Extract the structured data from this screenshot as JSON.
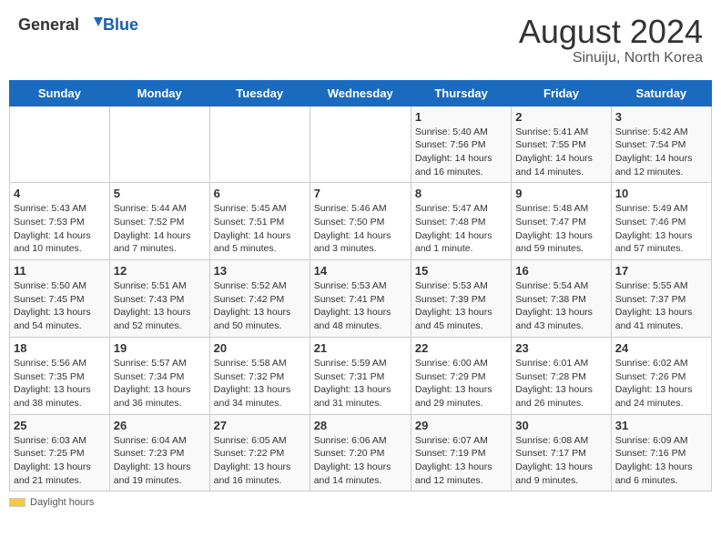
{
  "header": {
    "logo_general": "General",
    "logo_blue": "Blue",
    "title": "August 2024",
    "subtitle": "Sinuiju, North Korea"
  },
  "days_of_week": [
    "Sunday",
    "Monday",
    "Tuesday",
    "Wednesday",
    "Thursday",
    "Friday",
    "Saturday"
  ],
  "weeks": [
    [
      {
        "day": "",
        "info": ""
      },
      {
        "day": "",
        "info": ""
      },
      {
        "day": "",
        "info": ""
      },
      {
        "day": "",
        "info": ""
      },
      {
        "day": "1",
        "info": "Sunrise: 5:40 AM\nSunset: 7:56 PM\nDaylight: 14 hours and 16 minutes."
      },
      {
        "day": "2",
        "info": "Sunrise: 5:41 AM\nSunset: 7:55 PM\nDaylight: 14 hours and 14 minutes."
      },
      {
        "day": "3",
        "info": "Sunrise: 5:42 AM\nSunset: 7:54 PM\nDaylight: 14 hours and 12 minutes."
      }
    ],
    [
      {
        "day": "4",
        "info": "Sunrise: 5:43 AM\nSunset: 7:53 PM\nDaylight: 14 hours and 10 minutes."
      },
      {
        "day": "5",
        "info": "Sunrise: 5:44 AM\nSunset: 7:52 PM\nDaylight: 14 hours and 7 minutes."
      },
      {
        "day": "6",
        "info": "Sunrise: 5:45 AM\nSunset: 7:51 PM\nDaylight: 14 hours and 5 minutes."
      },
      {
        "day": "7",
        "info": "Sunrise: 5:46 AM\nSunset: 7:50 PM\nDaylight: 14 hours and 3 minutes."
      },
      {
        "day": "8",
        "info": "Sunrise: 5:47 AM\nSunset: 7:48 PM\nDaylight: 14 hours and 1 minute."
      },
      {
        "day": "9",
        "info": "Sunrise: 5:48 AM\nSunset: 7:47 PM\nDaylight: 13 hours and 59 minutes."
      },
      {
        "day": "10",
        "info": "Sunrise: 5:49 AM\nSunset: 7:46 PM\nDaylight: 13 hours and 57 minutes."
      }
    ],
    [
      {
        "day": "11",
        "info": "Sunrise: 5:50 AM\nSunset: 7:45 PM\nDaylight: 13 hours and 54 minutes."
      },
      {
        "day": "12",
        "info": "Sunrise: 5:51 AM\nSunset: 7:43 PM\nDaylight: 13 hours and 52 minutes."
      },
      {
        "day": "13",
        "info": "Sunrise: 5:52 AM\nSunset: 7:42 PM\nDaylight: 13 hours and 50 minutes."
      },
      {
        "day": "14",
        "info": "Sunrise: 5:53 AM\nSunset: 7:41 PM\nDaylight: 13 hours and 48 minutes."
      },
      {
        "day": "15",
        "info": "Sunrise: 5:53 AM\nSunset: 7:39 PM\nDaylight: 13 hours and 45 minutes."
      },
      {
        "day": "16",
        "info": "Sunrise: 5:54 AM\nSunset: 7:38 PM\nDaylight: 13 hours and 43 minutes."
      },
      {
        "day": "17",
        "info": "Sunrise: 5:55 AM\nSunset: 7:37 PM\nDaylight: 13 hours and 41 minutes."
      }
    ],
    [
      {
        "day": "18",
        "info": "Sunrise: 5:56 AM\nSunset: 7:35 PM\nDaylight: 13 hours and 38 minutes."
      },
      {
        "day": "19",
        "info": "Sunrise: 5:57 AM\nSunset: 7:34 PM\nDaylight: 13 hours and 36 minutes."
      },
      {
        "day": "20",
        "info": "Sunrise: 5:58 AM\nSunset: 7:32 PM\nDaylight: 13 hours and 34 minutes."
      },
      {
        "day": "21",
        "info": "Sunrise: 5:59 AM\nSunset: 7:31 PM\nDaylight: 13 hours and 31 minutes."
      },
      {
        "day": "22",
        "info": "Sunrise: 6:00 AM\nSunset: 7:29 PM\nDaylight: 13 hours and 29 minutes."
      },
      {
        "day": "23",
        "info": "Sunrise: 6:01 AM\nSunset: 7:28 PM\nDaylight: 13 hours and 26 minutes."
      },
      {
        "day": "24",
        "info": "Sunrise: 6:02 AM\nSunset: 7:26 PM\nDaylight: 13 hours and 24 minutes."
      }
    ],
    [
      {
        "day": "25",
        "info": "Sunrise: 6:03 AM\nSunset: 7:25 PM\nDaylight: 13 hours and 21 minutes."
      },
      {
        "day": "26",
        "info": "Sunrise: 6:04 AM\nSunset: 7:23 PM\nDaylight: 13 hours and 19 minutes."
      },
      {
        "day": "27",
        "info": "Sunrise: 6:05 AM\nSunset: 7:22 PM\nDaylight: 13 hours and 16 minutes."
      },
      {
        "day": "28",
        "info": "Sunrise: 6:06 AM\nSunset: 7:20 PM\nDaylight: 13 hours and 14 minutes."
      },
      {
        "day": "29",
        "info": "Sunrise: 6:07 AM\nSunset: 7:19 PM\nDaylight: 13 hours and 12 minutes."
      },
      {
        "day": "30",
        "info": "Sunrise: 6:08 AM\nSunset: 7:17 PM\nDaylight: 13 hours and 9 minutes."
      },
      {
        "day": "31",
        "info": "Sunrise: 6:09 AM\nSunset: 7:16 PM\nDaylight: 13 hours and 6 minutes."
      }
    ]
  ],
  "footer": {
    "daylight_label": "Daylight hours"
  }
}
